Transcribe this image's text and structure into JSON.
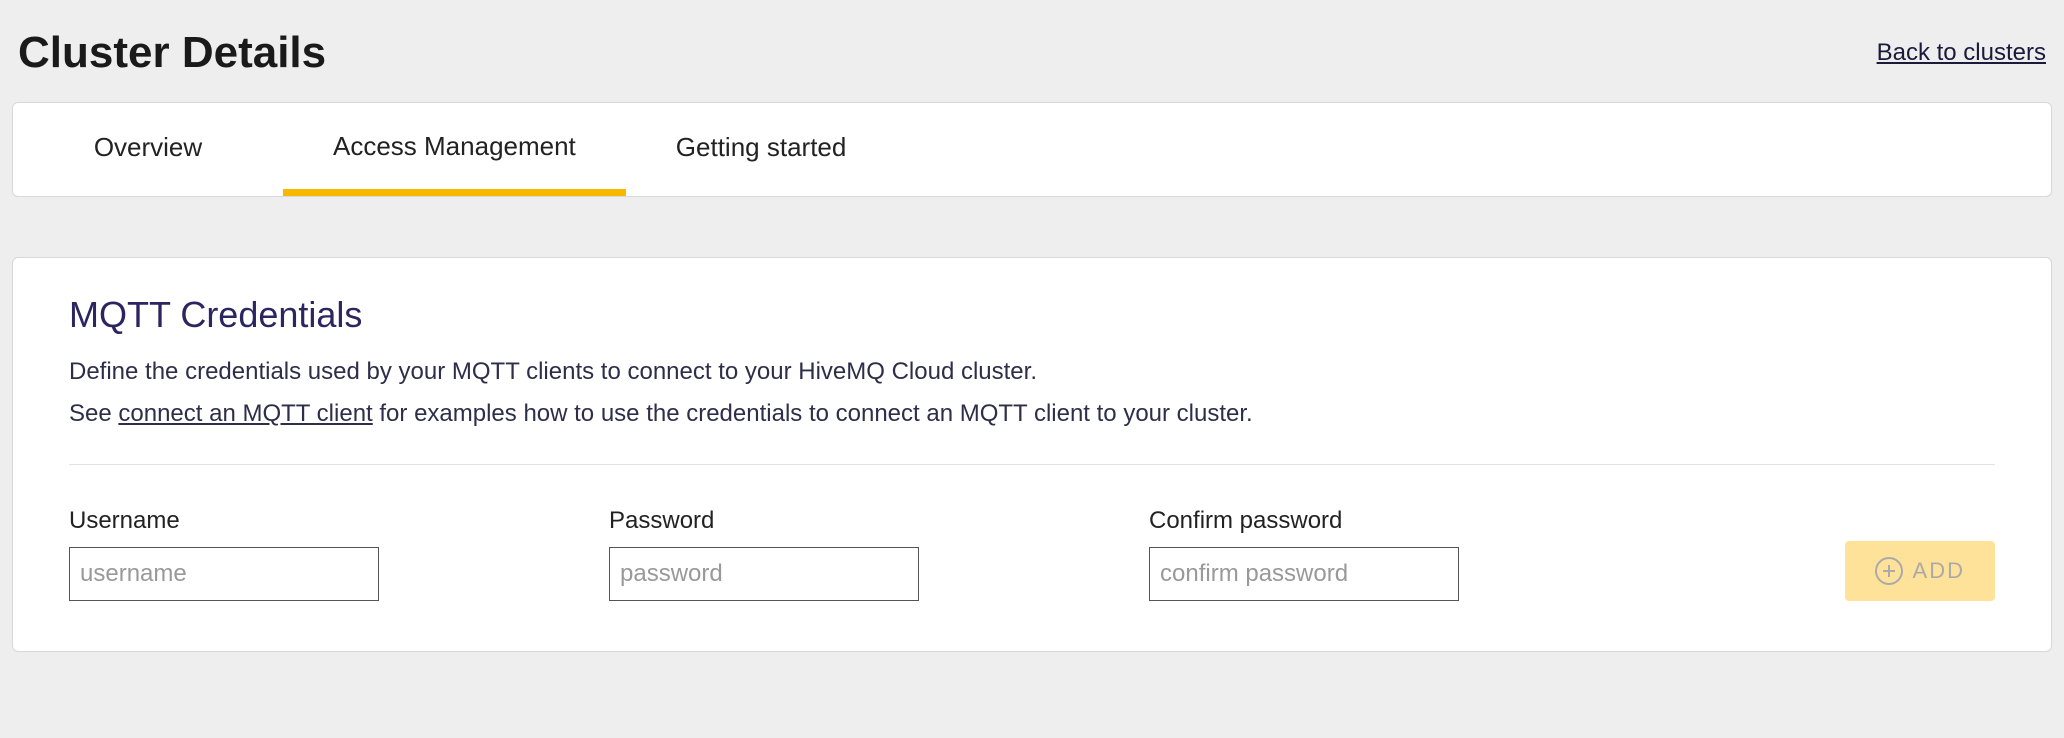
{
  "header": {
    "title": "Cluster Details",
    "back_link": "Back to clusters"
  },
  "tabs": [
    {
      "label": "Overview",
      "active": false
    },
    {
      "label": "Access Management",
      "active": true
    },
    {
      "label": "Getting started",
      "active": false
    }
  ],
  "section": {
    "title": "MQTT Credentials",
    "desc_line1": "Define the credentials used by your MQTT clients to connect to your HiveMQ Cloud cluster.",
    "desc_line2_prefix": "See ",
    "desc_line2_link": "connect an MQTT client",
    "desc_line2_suffix": " for examples how to use the credentials to connect an MQTT client to your cluster."
  },
  "form": {
    "username_label": "Username",
    "username_placeholder": "username",
    "password_label": "Password",
    "password_placeholder": "password",
    "confirm_label": "Confirm password",
    "confirm_placeholder": "confirm password",
    "add_label": "ADD"
  }
}
